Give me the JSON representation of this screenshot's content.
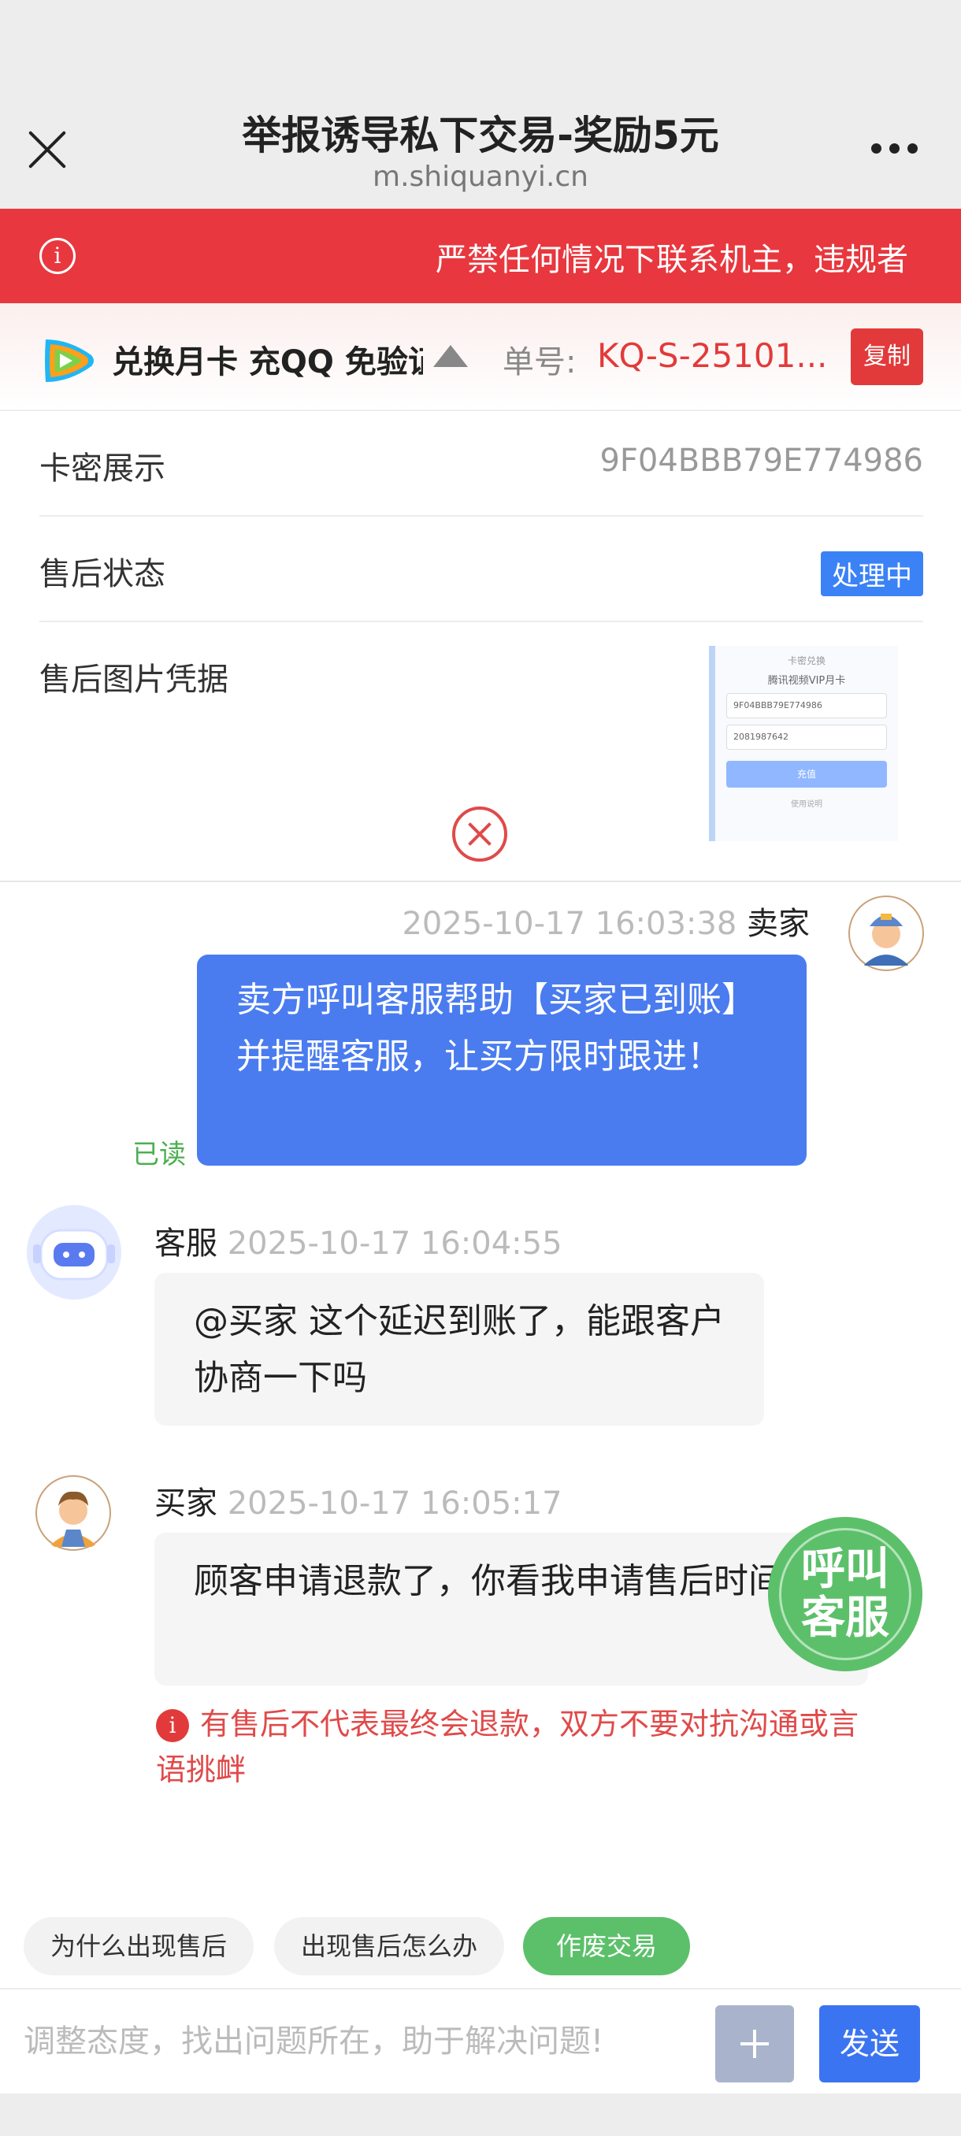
{
  "nav": {
    "title": "举报诱导私下交易-奖励5元",
    "url": "m.shiquanyi.cn"
  },
  "banner": {
    "notice": "严禁任何情况下联系机主，违规者"
  },
  "order": {
    "product": "兑换月卡 充QQ 免验证",
    "order_label": "单号:",
    "order_no": "KQ-S-25101...",
    "copy_label": "复制"
  },
  "details": {
    "card_label": "卡密展示",
    "card_value": "9F04BBB79E774986",
    "status_label": "售后状态",
    "status_value": "处理中",
    "evidence_label": "售后图片凭据",
    "evidence_img": {
      "title": "卡密兑换",
      "subtitle": "腾讯视频VIP月卡",
      "field1": "9F04BBB79E774986",
      "field2": "2081987642",
      "button": "充值",
      "footer": "使用说明"
    }
  },
  "messages": [
    {
      "sender": "卖家",
      "time": "2025-10-17 16:03:38",
      "text": "卖方呼叫客服帮助【买家已到账】并提醒客服，让买方限时跟进！",
      "read": "已读"
    },
    {
      "sender": "客服",
      "time": "2025-10-17 16:04:55",
      "text": "@买家 这个延迟到账了，能跟客户协商一下吗"
    },
    {
      "sender": "买家",
      "time": "2025-10-17 16:05:17",
      "text": "顾客申请退款了，你看我申请售后时间"
    }
  ],
  "warning": "有售后不代表最终会退款，双方不要对抗沟通或言语挑衅",
  "fab": {
    "line1": "呼叫",
    "line2": "客服"
  },
  "chips": [
    "为什么出现售后",
    "出现售后怎么办",
    "作废交易"
  ],
  "input": {
    "placeholder": "调整态度，找出问题所在，助于解决问题!",
    "send_label": "发送"
  },
  "colors": {
    "banner_red": "#e8373e",
    "accent_blue": "#4a7cf0",
    "fab_green": "#5cc06a"
  }
}
